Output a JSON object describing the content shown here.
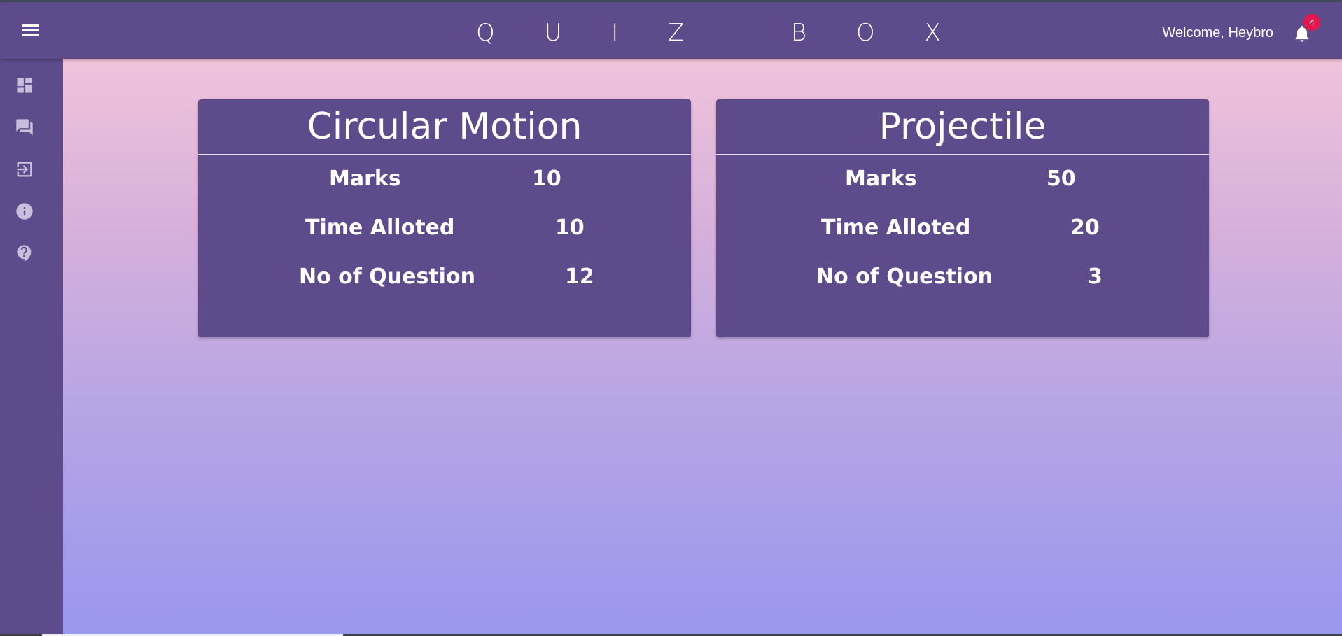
{
  "header": {
    "app_title": "Q U I Z   B O X",
    "welcome_text": "Welcome, Heybro",
    "notification_count": "4"
  },
  "sidebar": {
    "items": [
      {
        "icon": "dashboard-icon"
      },
      {
        "icon": "chat-icon"
      },
      {
        "icon": "login-icon"
      },
      {
        "icon": "info-icon"
      },
      {
        "icon": "help-icon"
      }
    ]
  },
  "quizzes": [
    {
      "title": "Circular Motion",
      "marks_label": "Marks",
      "marks": "10",
      "time_label": "Time Alloted",
      "time": "10",
      "questions_label": "No of Question",
      "questions": "12"
    },
    {
      "title": "Projectile",
      "marks_label": "Marks",
      "marks": "50",
      "time_label": "Time Alloted",
      "time": "20",
      "questions_label": "No of Question",
      "questions": "3"
    }
  ],
  "colors": {
    "primary": "#5e4b8b",
    "badge": "#e6174f",
    "gradient_top": "#efc3db",
    "gradient_bottom": "#9a97ee"
  }
}
